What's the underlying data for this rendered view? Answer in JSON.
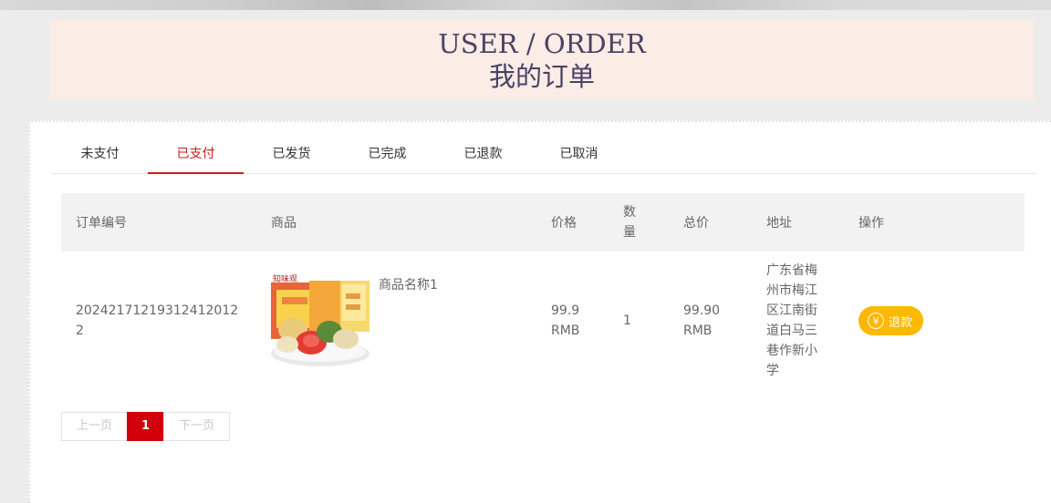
{
  "header": {
    "title_en": "USER / ORDER",
    "title_cn": "我的订单"
  },
  "tabs": [
    {
      "label": "未支付",
      "active": false
    },
    {
      "label": "已支付",
      "active": true
    },
    {
      "label": "已发货",
      "active": false
    },
    {
      "label": "已完成",
      "active": false
    },
    {
      "label": "已退款",
      "active": false
    },
    {
      "label": "已取消",
      "active": false
    }
  ],
  "table": {
    "headers": {
      "order_no": "订单编号",
      "product": "商品",
      "price": "价格",
      "qty": "数量",
      "total": "总价",
      "address": "地址",
      "action": "操作"
    },
    "rows": [
      {
        "order_no": "20242171219312412012​2",
        "product_image_icon": "mooncake-box-product-image",
        "product_image_text": "知味观",
        "product_name": "商品名称1",
        "price": "99.9 RMB",
        "qty": "1",
        "total": "99.90 RMB",
        "address": "广东省梅州市梅江区江南街道白马三巷作新小学",
        "action_label": "退款",
        "action_icon": "yen-circle-icon"
      }
    ]
  },
  "pager": {
    "prev_label": "上一页",
    "current_page": "1",
    "next_label": "下一页"
  },
  "colors": {
    "accent_red": "#c81e1e",
    "refund_yellow": "#ffb800",
    "banner_bg": "#fbece6",
    "title_color": "#4a4265"
  }
}
